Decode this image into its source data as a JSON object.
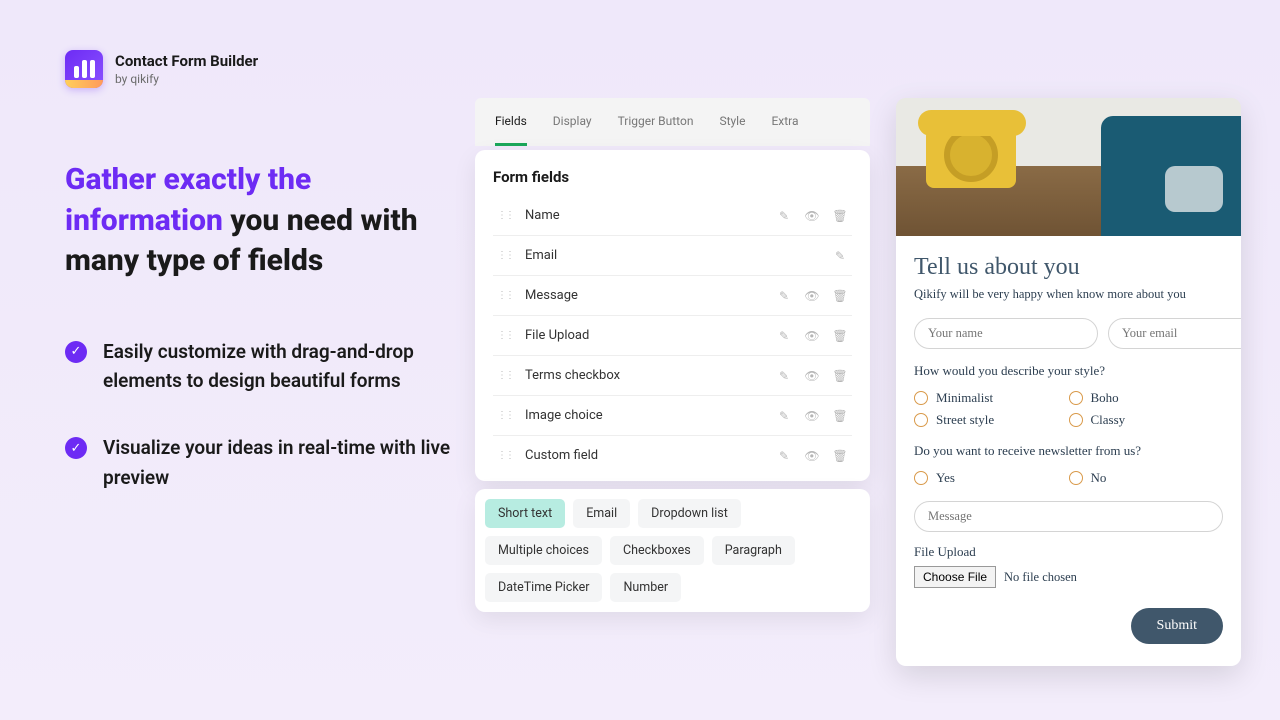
{
  "app": {
    "title": "Contact Form Builder",
    "subtitle": "by qikify"
  },
  "headline": {
    "accent": "Gather exactly the information",
    "rest": " you need with many type of fields"
  },
  "bullets": [
    "Easily customize with drag-and-drop elements to design beautiful forms",
    "Visualize your ideas in real-time with live preview"
  ],
  "builder": {
    "tabs": [
      "Fields",
      "Display",
      "Trigger Button",
      "Style",
      "Extra"
    ],
    "active_tab": 0,
    "section_title": "Form fields",
    "fields": [
      {
        "label": "Name",
        "actions": [
          "edit",
          "visibility",
          "delete"
        ]
      },
      {
        "label": "Email",
        "actions": [
          "edit"
        ]
      },
      {
        "label": "Message",
        "actions": [
          "edit",
          "visibility",
          "delete"
        ]
      },
      {
        "label": "File Upload",
        "actions": [
          "edit",
          "visibility",
          "delete"
        ]
      },
      {
        "label": "Terms checkbox",
        "actions": [
          "edit",
          "visibility",
          "delete"
        ]
      },
      {
        "label": "Image choice",
        "actions": [
          "edit",
          "visibility",
          "delete"
        ]
      },
      {
        "label": "Custom field",
        "actions": [
          "edit",
          "visibility",
          "delete"
        ]
      }
    ],
    "chips": [
      "Short text",
      "Email",
      "Dropdown list",
      "Multiple choices",
      "Checkboxes",
      "Paragraph",
      "DateTime Picker",
      "Number"
    ],
    "active_chip": 0
  },
  "preview": {
    "title": "Tell us about you",
    "subtitle": "Qikify will be very happy when know more about you",
    "name_placeholder": "Your name",
    "email_placeholder": "Your email",
    "q1": "How would you describe your style?",
    "q1_options": [
      "Minimalist",
      "Boho",
      "Street style",
      "Classy"
    ],
    "q2": "Do you want to receive newsletter from us?",
    "q2_options": [
      "Yes",
      "No"
    ],
    "message_placeholder": "Message",
    "file_label": "File Upload",
    "file_button": "Choose File",
    "file_status": "No file chosen",
    "submit": "Submit"
  }
}
